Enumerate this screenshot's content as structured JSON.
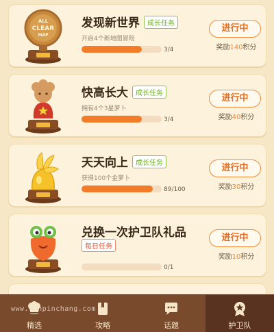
{
  "tasks": [
    {
      "title": "发现新世界",
      "tag": "成长任务",
      "tag_color": "green",
      "desc": "开启4个新地图冒险",
      "progress": 0.75,
      "count": "3/4",
      "button": "进行中",
      "reward_prefix": "奖励",
      "reward_num": "140",
      "reward_suffix": "积分",
      "trophy_text": "ALL CLEAR MAP",
      "trophy": "all-clear-medal"
    },
    {
      "title": "快高长大",
      "tag": "成长任务",
      "tag_color": "green",
      "desc": "拥有4个3星萝卜",
      "progress": 0.75,
      "count": "3/4",
      "button": "进行中",
      "reward_prefix": "奖励",
      "reward_num": "40",
      "reward_suffix": "积分",
      "trophy": "carrot-star-trophy"
    },
    {
      "title": "天天向上",
      "tag": "成长任务",
      "tag_color": "green",
      "desc": "获得100个金萝卜",
      "progress": 0.89,
      "count": "89/100",
      "button": "进行中",
      "reward_prefix": "奖励",
      "reward_num": "30",
      "reward_suffix": "积分",
      "trophy": "golden-carrot-trophy"
    },
    {
      "title": "兑换一次护卫队礼品",
      "tag": "每日任务",
      "tag_color": "red",
      "desc": "",
      "progress": 0,
      "count": "0/1",
      "button": "进行中",
      "reward_prefix": "奖励",
      "reward_num": "10",
      "reward_suffix": "积分",
      "trophy": "carrot-monster-trophy"
    }
  ],
  "tabs": [
    {
      "label": "精选",
      "icon": "chef-icon"
    },
    {
      "label": "攻略",
      "icon": "book-icon"
    },
    {
      "label": "话题",
      "icon": "chat-icon"
    },
    {
      "label": "护卫队",
      "icon": "badge-icon",
      "active": true
    }
  ],
  "watermark": "www.qinpinchang.com",
  "colors": {
    "accent": "#f17d2a",
    "tabbar": "#7a4a2c",
    "background": "#f6e7c6"
  }
}
